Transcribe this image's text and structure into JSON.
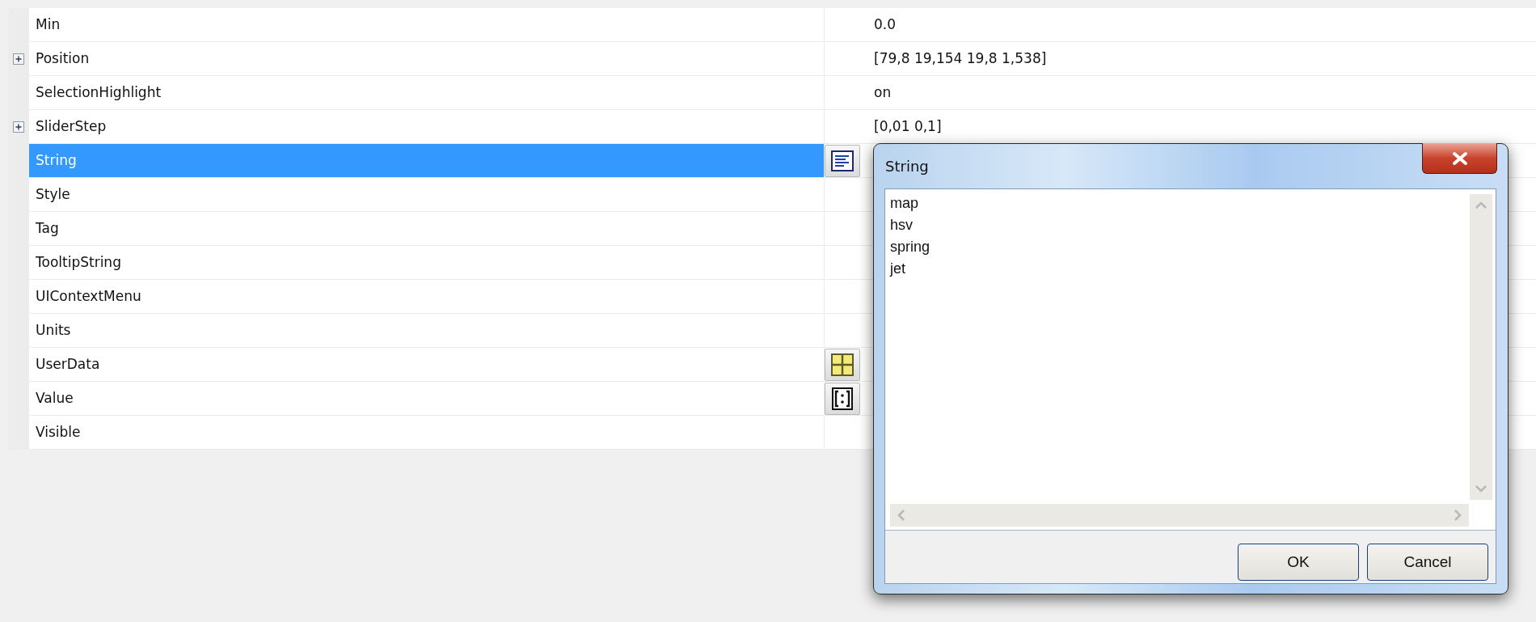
{
  "properties": [
    {
      "name": "Min",
      "value": "0.0",
      "expandable": false,
      "selected": false,
      "kind": "plain"
    },
    {
      "name": "Position",
      "value": "[79,8 19,154 19,8 1,538]",
      "expandable": true,
      "selected": false,
      "kind": "plain"
    },
    {
      "name": "SelectionHighlight",
      "value": "on",
      "expandable": false,
      "selected": false,
      "kind": "plain"
    },
    {
      "name": "SliderStep",
      "value": "[0,01 0,1]",
      "expandable": true,
      "selected": false,
      "kind": "plain"
    },
    {
      "name": "String",
      "expandable": false,
      "selected": true,
      "kind": "text"
    },
    {
      "name": "Style",
      "expandable": false,
      "selected": false,
      "kind": "plain"
    },
    {
      "name": "Tag",
      "expandable": false,
      "selected": false,
      "kind": "plain"
    },
    {
      "name": "TooltipString",
      "expandable": false,
      "selected": false,
      "kind": "plain"
    },
    {
      "name": "UIContextMenu",
      "expandable": false,
      "selected": false,
      "kind": "plain"
    },
    {
      "name": "Units",
      "expandable": false,
      "selected": false,
      "kind": "plain"
    },
    {
      "name": "UserData",
      "expandable": false,
      "selected": false,
      "kind": "grid"
    },
    {
      "name": "Value",
      "expandable": false,
      "selected": false,
      "kind": "matrix"
    },
    {
      "name": "Visible",
      "expandable": false,
      "selected": false,
      "kind": "plain"
    }
  ],
  "dialog": {
    "title": "String",
    "lines": [
      "map",
      "hsv",
      "spring",
      "jet"
    ],
    "buttons": [
      "OK",
      "Cancel"
    ]
  }
}
